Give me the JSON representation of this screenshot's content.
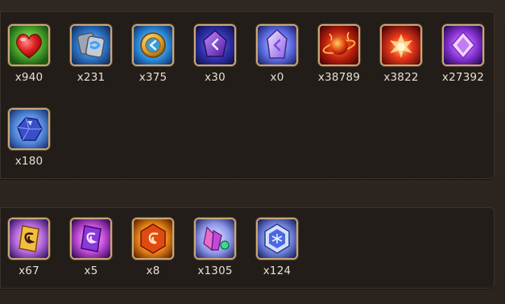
{
  "inventory": {
    "group1": [
      {
        "icon": "heart-icon",
        "count": "x940"
      },
      {
        "icon": "blue-swirl-scroll-icon",
        "count": "x231"
      },
      {
        "icon": "gold-swirl-coin-icon",
        "count": "x375"
      },
      {
        "icon": "purple-rune-crystal-icon",
        "count": "x30"
      },
      {
        "icon": "white-purple-crystal-icon",
        "count": "x0"
      },
      {
        "icon": "red-flame-planet-icon",
        "count": "x38789"
      },
      {
        "icon": "red-flame-burst-icon",
        "count": "x3822"
      },
      {
        "icon": "purple-diamond-icon",
        "count": "x27392"
      },
      {
        "icon": "blue-ore-icon",
        "count": "x180"
      }
    ],
    "group2": [
      {
        "icon": "gold-swirl-scroll-icon",
        "count": "x67"
      },
      {
        "icon": "purple-swirl-scroll-icon",
        "count": "x5"
      },
      {
        "icon": "orange-swirl-hexagon-icon",
        "count": "x8"
      },
      {
        "icon": "pink-crystal-shards-icon",
        "count": "x1305"
      },
      {
        "icon": "blue-hex-gem-icon",
        "count": "x124"
      }
    ]
  }
}
